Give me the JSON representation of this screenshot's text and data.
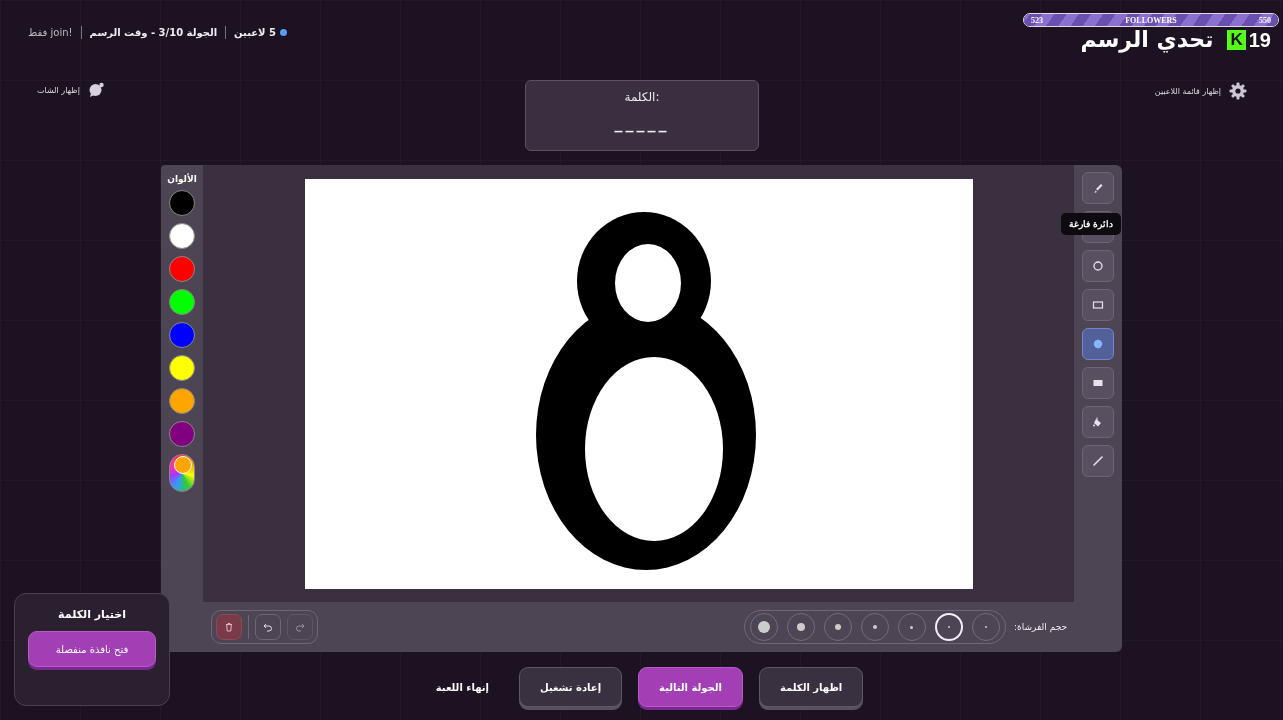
{
  "header": {
    "status": [
      {
        "kind": "players",
        "text": "5 لاعبين"
      },
      {
        "kind": "round",
        "text": "الجولة 3/10 - وقت الرسم"
      },
      {
        "kind": "mode",
        "text": "!join فقط"
      }
    ],
    "followers": {
      "start": "523",
      "label": "FOLLOWERS",
      "goal": "550",
      "level": 1
    },
    "title": "تحدي الرسم",
    "logo": {
      "letter": "K",
      "number": "19"
    }
  },
  "players_toggle": {
    "label": "إظهار قائمة اللاعبين"
  },
  "word_card": {
    "label": "الكلمة:",
    "hint": "_____"
  },
  "chat_toggle": {
    "label": "إظهار الشات"
  },
  "colors": {
    "title": "الألوان",
    "items": [
      {
        "kind": "swatch",
        "color": "#000000"
      },
      {
        "kind": "swatch",
        "color": "#ffffff"
      },
      {
        "kind": "swatch",
        "color": "#ff0000"
      },
      {
        "kind": "swatch",
        "color": "#00ff00"
      },
      {
        "kind": "swatch",
        "color": "#0000ff"
      },
      {
        "kind": "swatch",
        "color": "#ffff00"
      },
      {
        "kind": "swatch",
        "color": "#ffa500"
      },
      {
        "kind": "swatch",
        "color": "#800080"
      },
      {
        "kind": "picker"
      }
    ]
  },
  "tools": [
    {
      "kind": "brush",
      "selected": false
    },
    {
      "kind": "covered",
      "selected": false
    },
    {
      "kind": "empty-circle",
      "selected": false,
      "tooltip": "دائرة فارغة"
    },
    {
      "kind": "empty-rect",
      "selected": false
    },
    {
      "kind": "filled-circle",
      "selected": true
    },
    {
      "kind": "filled-rect",
      "selected": false
    },
    {
      "kind": "bucket",
      "selected": false
    },
    {
      "kind": "line",
      "selected": false
    }
  ],
  "brush_size": {
    "label": "حجم الفرشاة:",
    "sizes": [
      {
        "selected": false
      },
      {
        "selected": true
      },
      {
        "selected": false
      },
      {
        "selected": false
      },
      {
        "selected": false
      },
      {
        "selected": false
      },
      {
        "selected": false
      }
    ]
  },
  "history": [
    {
      "kind": "delete",
      "disabled": false
    },
    {
      "kind": "undo",
      "disabled": false
    },
    {
      "kind": "redo",
      "disabled": true
    }
  ],
  "actions": [
    {
      "kind": "secondary",
      "label": "اظهار الكلمة"
    },
    {
      "kind": "primary",
      "label": "الجولة التالية"
    },
    {
      "kind": "secondary",
      "label": "إعادة تشغيل"
    },
    {
      "kind": "text",
      "label": "إنهاء اللعبة"
    }
  ],
  "word_picker": {
    "title": "اختيار الكلمة",
    "button": "فتح نافذة منفصلة"
  }
}
